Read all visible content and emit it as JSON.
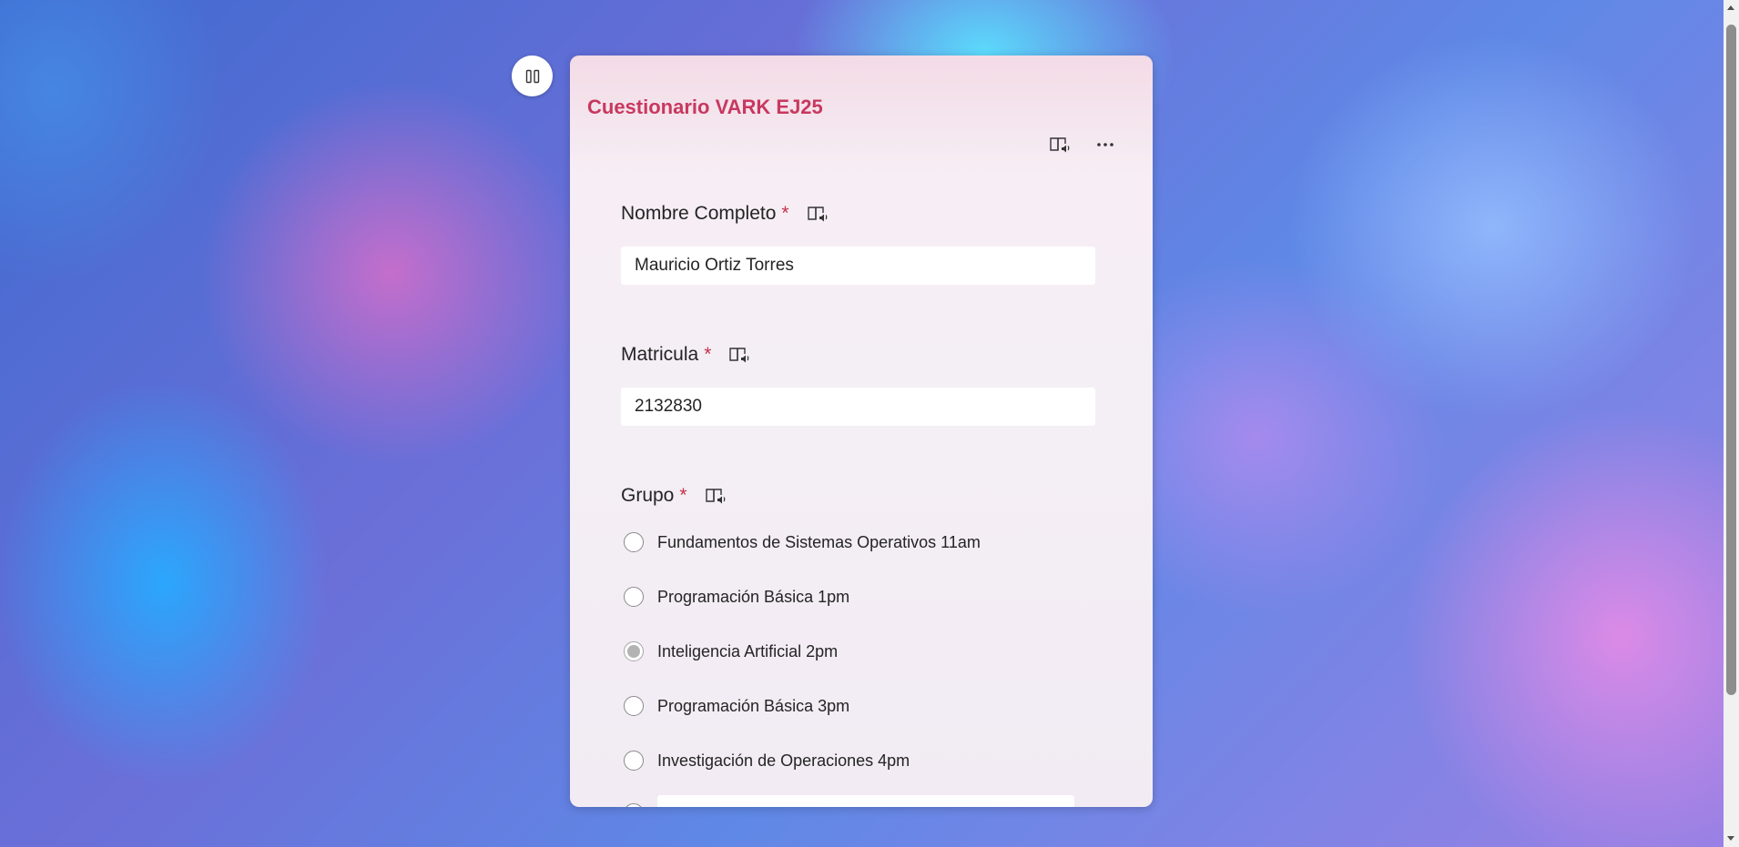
{
  "form": {
    "title": "Cuestionario VARK EJ25",
    "required_marker": "*"
  },
  "icons": {
    "pause": "pause-icon",
    "immersive_reader": "immersive-reader-icon",
    "more": "more-options-icon"
  },
  "questions": {
    "nombre": {
      "label": "Nombre Completo",
      "value": "Mauricio Ortiz Torres"
    },
    "matricula": {
      "label": "Matricula",
      "value": "2132830"
    },
    "grupo": {
      "label": "Grupo",
      "selected": "Inteligencia Artificial 2pm",
      "options": [
        "Fundamentos de Sistemas Operativos 11am",
        "Programación Básica 1pm",
        "Inteligencia Artificial 2pm",
        "Programación Básica 3pm",
        "Investigación de Operaciones 4pm"
      ]
    }
  },
  "colors": {
    "title": "#c8385f",
    "required": "#c4314b",
    "text": "#242424"
  }
}
